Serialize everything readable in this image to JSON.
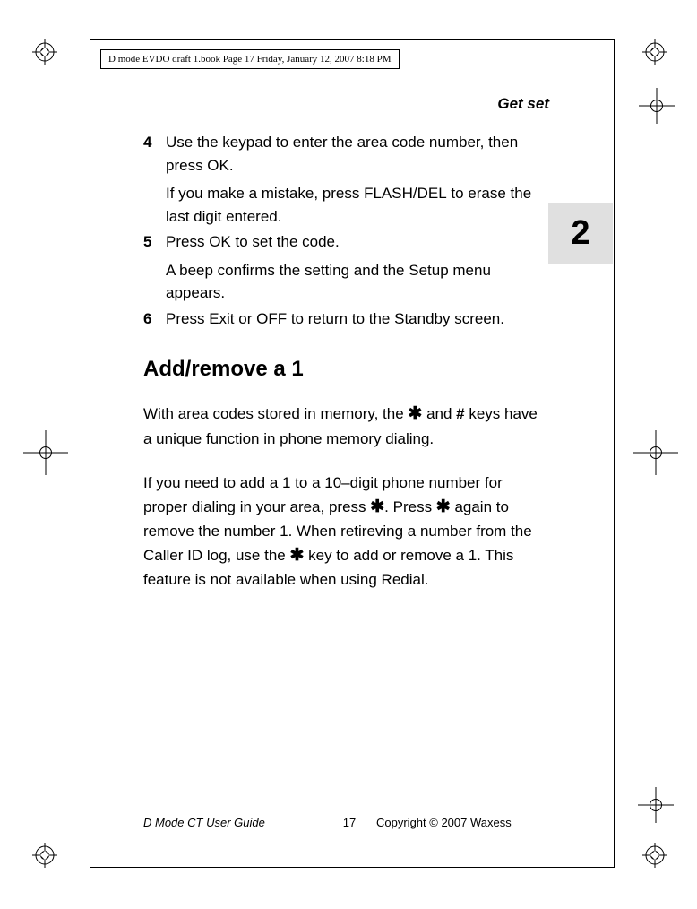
{
  "header_info": "D mode EVDO draft 1.book  Page 17  Friday, January 12, 2007  8:18 PM",
  "running_header": "Get set",
  "chapter_tab": "2",
  "step4": {
    "num": "4",
    "line1_a": "Use the keypad to enter the area code number, then press ",
    "line1_key": "OK",
    "line1_b": ".",
    "sub_a": "If you make a mistake, press ",
    "sub_key": "FLASH/DEL",
    "sub_b": " to erase the last digit entered."
  },
  "step5": {
    "num": "5",
    "line1_a": "Press ",
    "line1_key": "OK",
    "line1_b": " to set the code.",
    "sub": "A beep confirms the setting and the Setup menu appears."
  },
  "step6": {
    "num": "6",
    "line1_a": "Press ",
    "line1_key1": "Exit",
    "line1_mid": " or ",
    "line1_key2": "OFF",
    "line1_b": " to return to the Standby screen."
  },
  "heading": "Add/remove a 1",
  "para1_a": "With area codes stored in memory, the ",
  "para1_b": " and ",
  "para1_c": " keys have a unique function in phone memory dialing.",
  "para2_a": "If you need to add a 1 to a 10–digit phone number for proper dialing in your area, press ",
  "para2_b": ". Press ",
  "para2_c": " again to remove the number 1. When retireving a number from the Caller ID log, use the ",
  "para2_d": " key to add or remove a 1. This feature is not available when using Redial.",
  "footer": {
    "left": "D Mode CT User Guide",
    "center": "17",
    "right": "Copyright © 2007 Waxess"
  }
}
